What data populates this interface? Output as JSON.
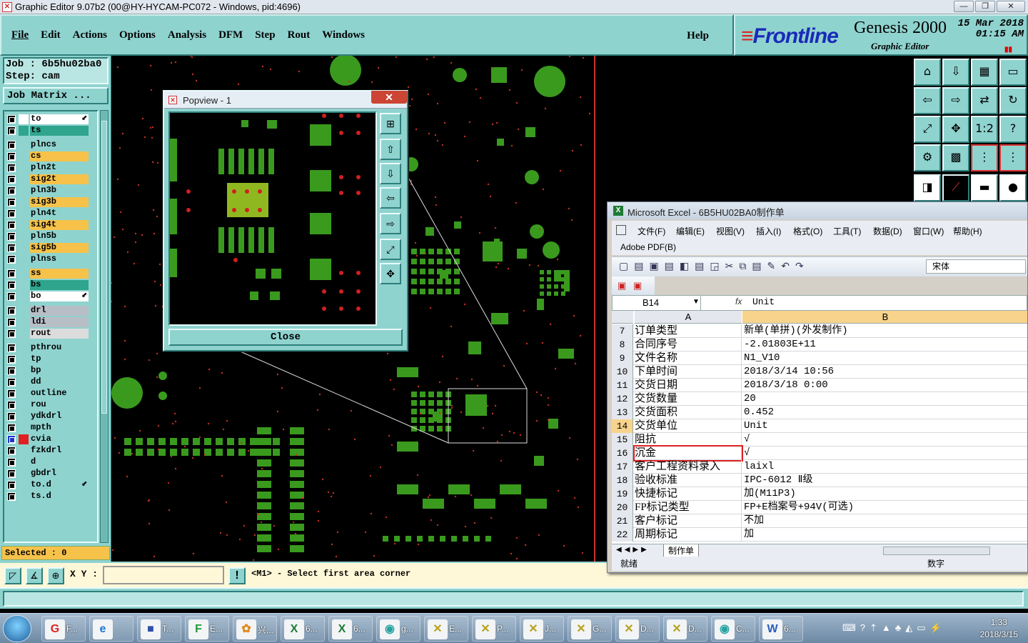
{
  "window": {
    "title": "Graphic Editor 9.07b2 (00@HY-HYCAM-PC072 - Windows, pid:4696)",
    "controls": [
      "—",
      "❐",
      "✕"
    ]
  },
  "menubar": {
    "items": [
      "File",
      "Edit",
      "Actions",
      "Options",
      "Analysis",
      "DFM",
      "Step",
      "Rout",
      "Windows"
    ],
    "help": "Help"
  },
  "brand": {
    "logo": "Frontline",
    "product": "Genesis 2000",
    "subtitle": "Graphic Editor",
    "date": "15 Mar 2018",
    "time": "01:15 AM"
  },
  "job": {
    "job_line": "Job  : 6b5hu02ba0",
    "step_line": "Step: cam",
    "matrix_button": "Job Matrix ..."
  },
  "layers": [
    {
      "name": "to",
      "color": "#ffffff",
      "swatch": "#ffffff",
      "flag": true
    },
    {
      "name": "ts",
      "color": "#2fa58e",
      "swatch": "#2fa58e"
    },
    {
      "name": "plncs",
      "color": "#8fd3cf",
      "swatch": "#8fd3cf"
    },
    {
      "name": "cs",
      "color": "#f6c24a",
      "swatch": "#8fd3cf"
    },
    {
      "name": "pln2t",
      "color": "#8fd3cf",
      "swatch": "#8fd3cf"
    },
    {
      "name": "sig2t",
      "color": "#f6c24a",
      "swatch": "#8fd3cf"
    },
    {
      "name": "pln3b",
      "color": "#8fd3cf",
      "swatch": "#8fd3cf"
    },
    {
      "name": "sig3b",
      "color": "#f6c24a",
      "swatch": "#8fd3cf"
    },
    {
      "name": "pln4t",
      "color": "#8fd3cf",
      "swatch": "#8fd3cf"
    },
    {
      "name": "sig4t",
      "color": "#f6c24a",
      "swatch": "#8fd3cf"
    },
    {
      "name": "pln5b",
      "color": "#8fd3cf",
      "swatch": "#8fd3cf"
    },
    {
      "name": "sig5b",
      "color": "#f6c24a",
      "swatch": "#8fd3cf"
    },
    {
      "name": "plnss",
      "color": "#8fd3cf",
      "swatch": "#8fd3cf"
    },
    {
      "name": "ss",
      "color": "#f6c24a",
      "swatch": "#8fd3cf"
    },
    {
      "name": "bs",
      "color": "#2fa58e",
      "swatch": "#8fd3cf"
    },
    {
      "name": "bo",
      "color": "#ffffff",
      "swatch": "#8fd3cf",
      "flag": true
    },
    {
      "name": "drl",
      "color": "#b8bec6",
      "swatch": "#8fd3cf"
    },
    {
      "name": "ldi",
      "color": "#b8bec6",
      "swatch": "#8fd3cf"
    },
    {
      "name": "rout",
      "color": "#dcdcdc",
      "swatch": "#8fd3cf"
    },
    {
      "name": "pthrou",
      "color": "#8fd3cf",
      "swatch": "#8fd3cf"
    },
    {
      "name": "tp",
      "color": "#8fd3cf",
      "swatch": "#8fd3cf"
    },
    {
      "name": "bp",
      "color": "#8fd3cf",
      "swatch": "#8fd3cf"
    },
    {
      "name": "dd",
      "color": "#8fd3cf",
      "swatch": "#8fd3cf"
    },
    {
      "name": "outline",
      "color": "#8fd3cf",
      "swatch": "#8fd3cf"
    },
    {
      "name": "rou",
      "color": "#8fd3cf",
      "swatch": "#8fd3cf"
    },
    {
      "name": "ydkdrl",
      "color": "#8fd3cf",
      "swatch": "#8fd3cf"
    },
    {
      "name": "mpth",
      "color": "#8fd3cf",
      "swatch": "#8fd3cf"
    },
    {
      "name": "cvia",
      "color": "#8fd3cf",
      "swatch": "#e02020",
      "active": true
    },
    {
      "name": "fzkdrl",
      "color": "#8fd3cf",
      "swatch": "#8fd3cf"
    },
    {
      "name": "d",
      "color": "#8fd3cf",
      "swatch": "#8fd3cf"
    },
    {
      "name": "gbdrl",
      "color": "#8fd3cf",
      "swatch": "#8fd3cf"
    },
    {
      "name": "to.d",
      "color": "#8fd3cf",
      "swatch": "#8fd3cf",
      "flag": true
    },
    {
      "name": "ts.d",
      "color": "#8fd3cf",
      "swatch": "#8fd3cf"
    }
  ],
  "selected_text": "Selected : 0",
  "statusbar": {
    "xy_label": "X Y :",
    "xy_value": "",
    "message": "<M1> - Select first area corner"
  },
  "popview": {
    "title": "Popview - 1",
    "close_label": "Close",
    "close_x": "✕"
  },
  "excel": {
    "title": "Microsoft Excel - 6B5HU02BA0制作单",
    "menu": [
      "文件(F)",
      "编辑(E)",
      "视图(V)",
      "插入(I)",
      "格式(O)",
      "工具(T)",
      "数据(D)",
      "窗口(W)",
      "帮助(H)"
    ],
    "pdf_menu": "Adobe PDF(B)",
    "font_name": "宋体",
    "name_box": "B14",
    "fx": "fx",
    "formula_value": "Unit",
    "col_headers": [
      "A",
      "B"
    ],
    "rows": [
      {
        "n": "7",
        "a": "订单类型",
        "b": "新单(单拼)(外发制作)"
      },
      {
        "n": "8",
        "a": "合同序号",
        "b": "-2.01803E+11"
      },
      {
        "n": "9",
        "a": "文件名称",
        "b": "N1_V10"
      },
      {
        "n": "10",
        "a": "下单时间",
        "b": "2018/3/14 10:56"
      },
      {
        "n": "11",
        "a": "交货日期",
        "b": "2018/3/18 0:00"
      },
      {
        "n": "12",
        "a": "交货数量",
        "b": "20"
      },
      {
        "n": "13",
        "a": "交货面积",
        "b": "0.452"
      },
      {
        "n": "14",
        "a": "交货单位",
        "b": "Unit"
      },
      {
        "n": "15",
        "a": "阻抗",
        "b": "√"
      },
      {
        "n": "16",
        "a": "沉金",
        "b": "√"
      },
      {
        "n": "17",
        "a": "客户工程资料录入",
        "b": "laixl"
      },
      {
        "n": "18",
        "a": "验收标准",
        "b": "IPC-6012 Ⅱ级"
      },
      {
        "n": "19",
        "a": "快捷标记",
        "b": "加(M11P3)"
      },
      {
        "n": "20",
        "a": "FP标记类型",
        "b": "FP+E档案号+94V(可选)"
      },
      {
        "n": "21",
        "a": "客户标记",
        "b": "不加"
      },
      {
        "n": "22",
        "a": "周期标记",
        "b": "加"
      }
    ],
    "sheet_tab": "制作单",
    "status_ready": "就绪",
    "status_num": "数字"
  },
  "taskbar": {
    "items": [
      {
        "label": "F...",
        "icon": "G",
        "color": "#d22"
      },
      {
        "label": "",
        "icon": "e",
        "color": "#1b76d1"
      },
      {
        "label": "T...",
        "icon": "■",
        "color": "#2a4fa8"
      },
      {
        "label": "E...",
        "icon": "F",
        "color": "#1c9a3a"
      },
      {
        "label": "兴...",
        "icon": "✿",
        "color": "#e08a1c"
      },
      {
        "label": "6...",
        "icon": "X",
        "color": "#1e7b34"
      },
      {
        "label": "6...",
        "icon": "X",
        "color": "#1e7b34"
      },
      {
        "label": "g...",
        "icon": "◉",
        "color": "#2aa3a3"
      },
      {
        "label": "E...",
        "icon": "✕",
        "color": "#b8a220"
      },
      {
        "label": "P...",
        "icon": "✕",
        "color": "#b8a220"
      },
      {
        "label": "J...",
        "icon": "✕",
        "color": "#b8a220"
      },
      {
        "label": "G...",
        "icon": "✕",
        "color": "#b8a220"
      },
      {
        "label": "D...",
        "icon": "✕",
        "color": "#b8a220"
      },
      {
        "label": "D...",
        "icon": "✕",
        "color": "#b8a220"
      },
      {
        "label": "C...",
        "icon": "◉",
        "color": "#2aa3a3"
      },
      {
        "label": "6...",
        "icon": "W",
        "color": "#2a5fb8"
      }
    ],
    "time": "1:33",
    "date": "2018/3/15"
  }
}
